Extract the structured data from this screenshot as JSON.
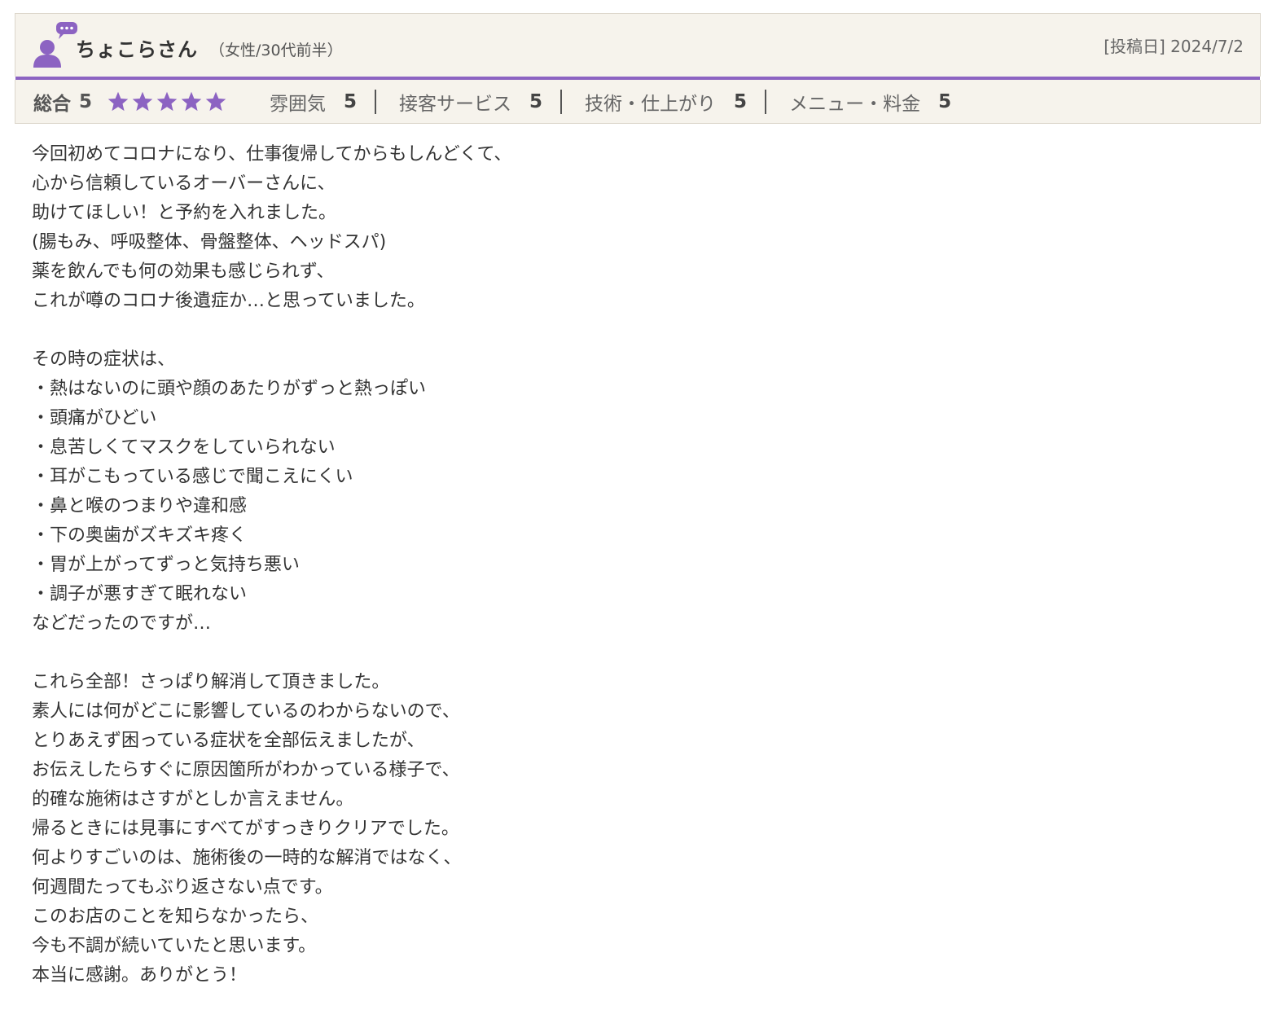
{
  "reviewer": {
    "name": "ちょこらさん",
    "meta": "（女性/30代前半）",
    "post_date": "[投稿日] 2024/7/2",
    "avatar_icon": "person-speech-bubble-icon"
  },
  "ratings": {
    "overall_label": "総合",
    "overall_score": "5",
    "stars_filled": 5,
    "stars_total": 5,
    "star_color": "#8c63c2",
    "categories": [
      {
        "label": "雰囲気",
        "score": "5"
      },
      {
        "label": "接客サービス",
        "score": "5"
      },
      {
        "label": "技術・仕上がり",
        "score": "5"
      },
      {
        "label": "メニュー・料金",
        "score": "5"
      }
    ]
  },
  "colors": {
    "accent": "#8c63c2",
    "header_bg": "#f6f3ec",
    "border": "#dcd6cb"
  },
  "review": {
    "lines": [
      "今回初めてコロナになり、仕事復帰してからもしんどくて、",
      "心から信頼しているオーバーさんに、",
      "助けてほしい！と予約を入れました。",
      "(腸もみ、呼吸整体、骨盤整体、ヘッドスパ)",
      "薬を飲んでも何の効果も感じられず、",
      "これが噂のコロナ後遺症か…と思っていました。",
      "",
      "その時の症状は、",
      "・熱はないのに頭や顔のあたりがずっと熱っぽい",
      "・頭痛がひどい",
      "・息苦しくてマスクをしていられない",
      "・耳がこもっている感じで聞こえにくい",
      "・鼻と喉のつまりや違和感",
      "・下の奥歯がズキズキ疼く",
      "・胃が上がってずっと気持ち悪い",
      "・調子が悪すぎて眠れない",
      "などだったのですが…",
      "",
      "これら全部！さっぱり解消して頂きました。",
      "素人には何がどこに影響しているのわからないので、",
      "とりあえず困っている症状を全部伝えましたが、",
      "お伝えしたらすぐに原因箇所がわかっている様子で、",
      "的確な施術はさすがとしか言えません。",
      "帰るときには見事にすべてがすっきりクリアでした。",
      "何よりすごいのは、施術後の一時的な解消ではなく、",
      "何週間たってもぶり返さない点です。",
      "このお店のことを知らなかったら、",
      "今も不調が続いていたと思います。",
      "本当に感謝。ありがとう！"
    ]
  }
}
